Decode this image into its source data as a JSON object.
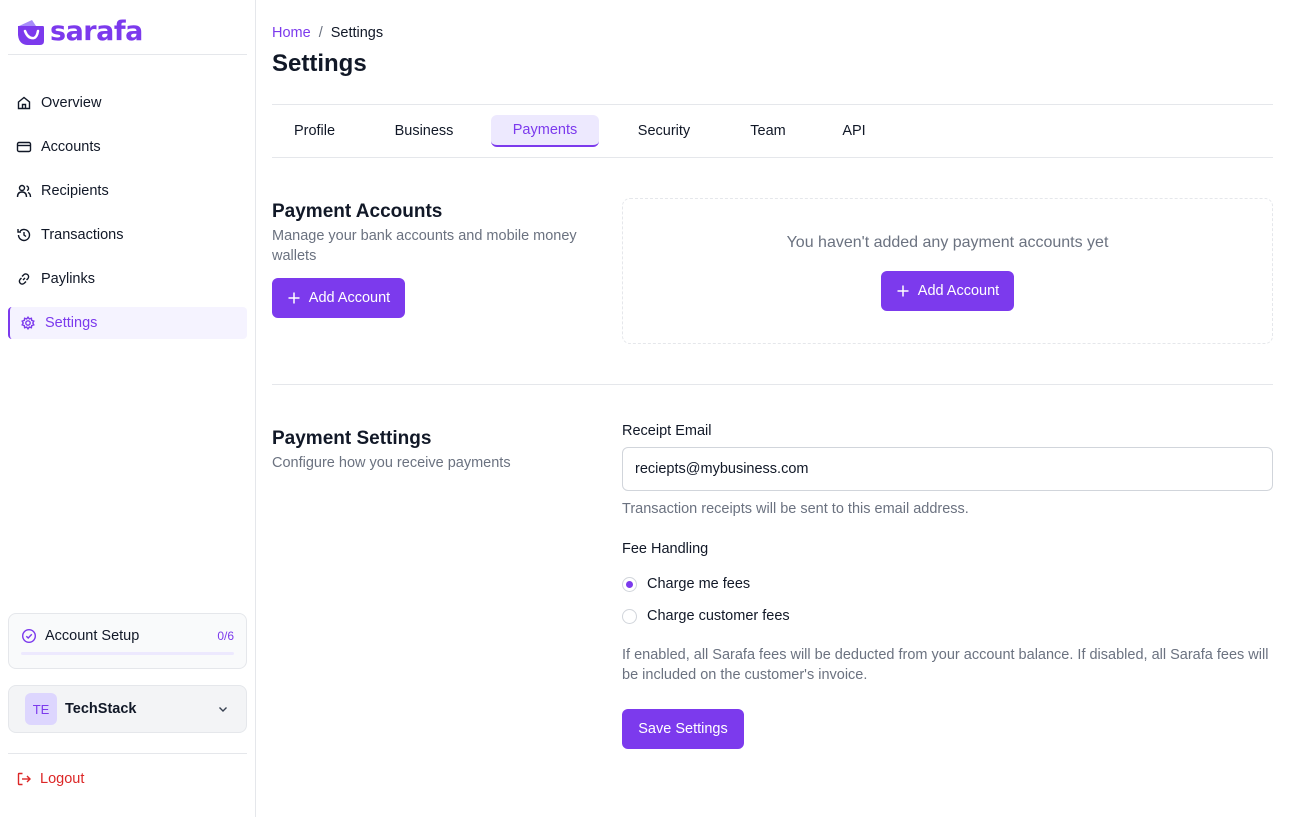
{
  "brand": {
    "name": "sarafa",
    "color": "#7c3aed"
  },
  "sidebar": {
    "items": [
      {
        "label": "Overview",
        "icon": "home-icon",
        "active": false
      },
      {
        "label": "Accounts",
        "icon": "credit-card-icon",
        "active": false
      },
      {
        "label": "Recipients",
        "icon": "users-icon",
        "active": false
      },
      {
        "label": "Transactions",
        "icon": "history-icon",
        "active": false
      },
      {
        "label": "Paylinks",
        "icon": "link-icon",
        "active": false
      },
      {
        "label": "Settings",
        "icon": "gear-icon",
        "active": true
      }
    ],
    "setup": {
      "label": "Account Setup",
      "count": "0/6",
      "progress": 0
    },
    "org": {
      "initials": "TE",
      "name": "TechStack"
    },
    "logout_label": "Logout"
  },
  "header": {
    "breadcrumb": {
      "home": "Home",
      "separator": "/",
      "current": "Settings"
    },
    "title": "Settings"
  },
  "tabs": [
    {
      "label": "Profile",
      "active": false
    },
    {
      "label": "Business",
      "active": false
    },
    {
      "label": "Payments",
      "active": true
    },
    {
      "label": "Security",
      "active": false
    },
    {
      "label": "Team",
      "active": false
    },
    {
      "label": "API",
      "active": false
    }
  ],
  "payment_accounts": {
    "title": "Payment Accounts",
    "description": "Manage your bank accounts and mobile money wallets",
    "add_label": "Add Account",
    "empty_text": "You haven't added any payment accounts yet",
    "empty_add_label": "Add Account"
  },
  "payment_settings": {
    "title": "Payment Settings",
    "description": "Configure how you receive payments",
    "receipt_email_label": "Receipt Email",
    "receipt_email_value": "reciepts@mybusiness.com",
    "receipt_email_hint": "Transaction receipts will be sent to this email address.",
    "fee_label": "Fee Handling",
    "fee_options": [
      {
        "label": "Charge me fees",
        "checked": true
      },
      {
        "label": "Charge customer fees",
        "checked": false
      }
    ],
    "fee_hint": "If enabled, all Sarafa fees will be deducted from your account balance. If disabled, all Sarafa fees will be included on the customer's invoice.",
    "save_label": "Save Settings"
  }
}
